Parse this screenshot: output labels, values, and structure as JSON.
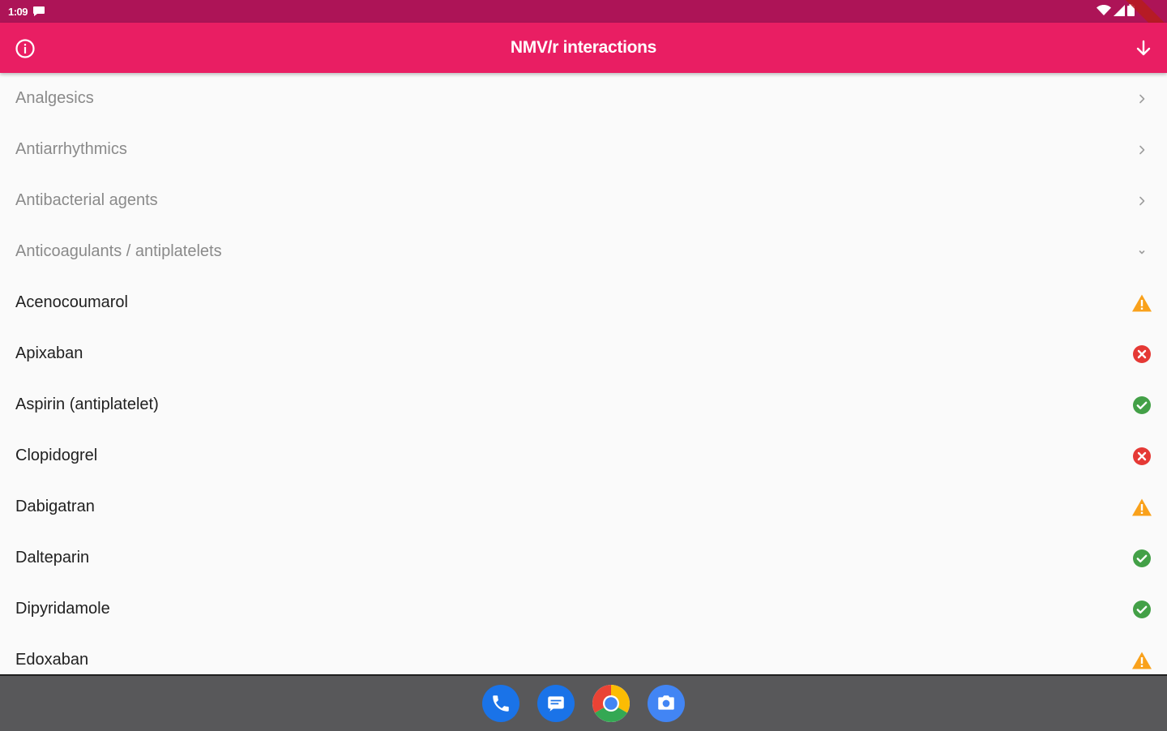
{
  "status_bar": {
    "time": "1:09"
  },
  "app_bar": {
    "title": "NMV/r interactions"
  },
  "list": {
    "items": [
      {
        "label": "Analgesics",
        "type": "category",
        "trailing": "chevron-right"
      },
      {
        "label": "Antiarrhythmics",
        "type": "category",
        "trailing": "chevron-right"
      },
      {
        "label": "Antibacterial agents",
        "type": "category",
        "trailing": "chevron-right"
      },
      {
        "label": "Anticoagulants / antiplatelets",
        "type": "category",
        "trailing": "chevron-down"
      },
      {
        "label": "Acenocoumarol",
        "type": "drug",
        "trailing": "warning"
      },
      {
        "label": "Apixaban",
        "type": "drug",
        "trailing": "error"
      },
      {
        "label": "Aspirin (antiplatelet)",
        "type": "drug",
        "trailing": "ok"
      },
      {
        "label": "Clopidogrel",
        "type": "drug",
        "trailing": "error"
      },
      {
        "label": "Dabigatran",
        "type": "drug",
        "trailing": "warning"
      },
      {
        "label": "Dalteparin",
        "type": "drug",
        "trailing": "ok"
      },
      {
        "label": "Dipyridamole",
        "type": "drug",
        "trailing": "ok"
      },
      {
        "label": "Edoxaban",
        "type": "drug",
        "trailing": "warning"
      }
    ]
  },
  "colors": {
    "status_bar": "#ad1457",
    "app_bar": "#e91e63",
    "warning": "#f9a11b",
    "error": "#e53935",
    "ok": "#43a047",
    "nav_bar": "#58585a"
  },
  "dock": {
    "apps": [
      "phone-icon",
      "messages-icon",
      "chrome-icon",
      "camera-icon"
    ]
  }
}
